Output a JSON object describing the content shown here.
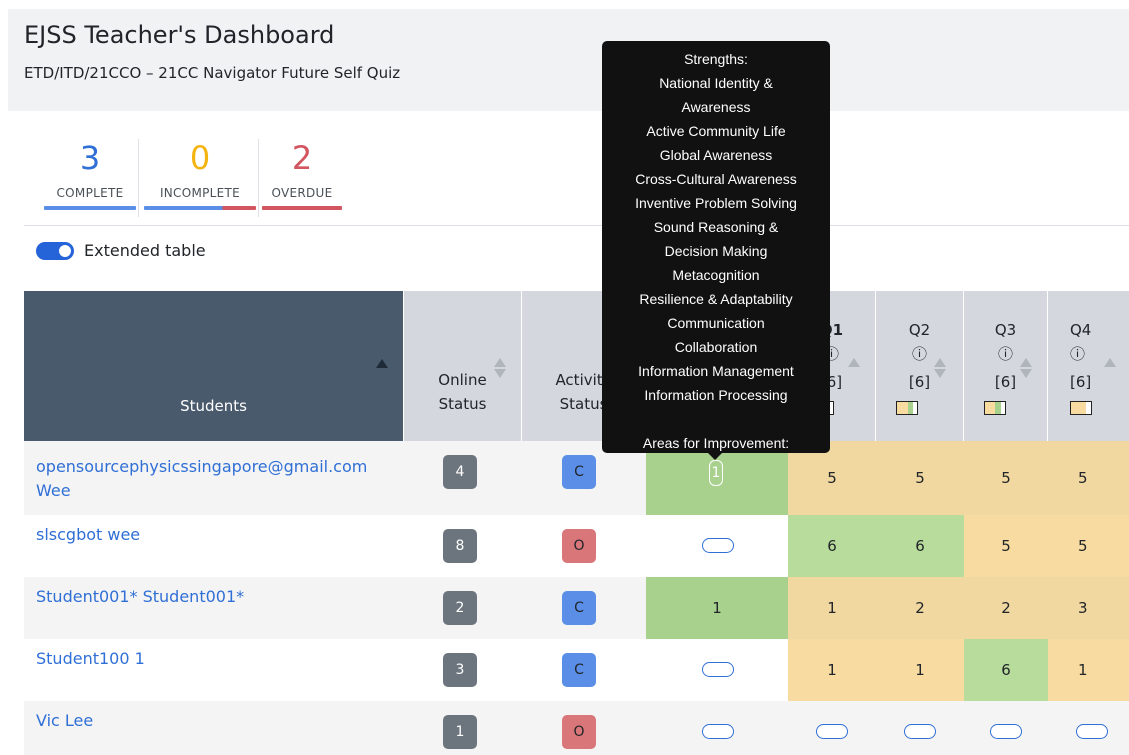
{
  "header": {
    "title": "EJSS Teacher's Dashboard",
    "subtitle": "ETD/ITD/21CCO – 21CC Navigator Future Self Quiz"
  },
  "summary": [
    {
      "value": "3",
      "label": "COMPLETE",
      "color": "#2f6fd6"
    },
    {
      "value": "0",
      "label": "INCOMPLETE",
      "color": "#f5b30f"
    },
    {
      "value": "2",
      "label": "OVERDUE",
      "color": "#d2555f"
    }
  ],
  "toggle": {
    "label": "Extended table",
    "on": true
  },
  "table": {
    "headers": {
      "students": "Students",
      "online": [
        "Online",
        "Status"
      ],
      "activity": [
        "Activity",
        "Status"
      ],
      "q1": {
        "label": "Q1",
        "info": "ⓘ",
        "max": "[6]"
      },
      "q2": {
        "label": "Q2",
        "info": "ⓘ",
        "max": "[6]"
      },
      "q3": {
        "label": "Q3",
        "info": "ⓘ",
        "max": "[6]"
      },
      "q4": {
        "label": "Q4",
        "info": "ⓘ",
        "max": "[6]"
      }
    },
    "rows": [
      {
        "name": [
          "opensourcephysicssingapore@gmail.com",
          "Wee"
        ],
        "online": "4",
        "activity": "C",
        "q0": "1",
        "q1": "5",
        "q2": "5",
        "q3": "5",
        "q4": "5"
      },
      {
        "name": [
          "slscgbot wee"
        ],
        "online": "8",
        "activity": "O",
        "q0": "",
        "q1": "6",
        "q2": "6",
        "q3": "5",
        "q4": "5"
      },
      {
        "name": [
          "Student001* Student001*"
        ],
        "online": "2",
        "activity": "C",
        "q0": "1",
        "q1": "1",
        "q2": "2",
        "q3": "2",
        "q4": "3"
      },
      {
        "name": [
          "Student100 1"
        ],
        "online": "3",
        "activity": "C",
        "q0": "",
        "q1": "1",
        "q2": "1",
        "q3": "6",
        "q4": "1"
      },
      {
        "name": [
          "Vic Lee"
        ],
        "online": "1",
        "activity": "O",
        "q0": "",
        "q1": "",
        "q2": "",
        "q3": "",
        "q4": ""
      }
    ]
  },
  "tooltip": {
    "strengths_title": "Strengths:",
    "strengths": [
      "National Identity &",
      "Awareness",
      "Active Community Life",
      "Global Awareness",
      "Cross-Cultural Awareness",
      "Inventive Problem Solving",
      "Sound Reasoning &",
      "Decision Making",
      "Metacognition",
      "Resilience & Adaptability",
      "Communication",
      "Collaboration",
      "Information Management",
      "Information Processing"
    ],
    "improvement_title": "Areas for Improvement:"
  },
  "colors": {
    "green": "#a9d18e",
    "light_green": "#b8dc9c",
    "orange": "#f8dba0",
    "blue_badge": "#5b8ee6",
    "red_badge": "#d9767a",
    "link": "#2f6fd6"
  }
}
